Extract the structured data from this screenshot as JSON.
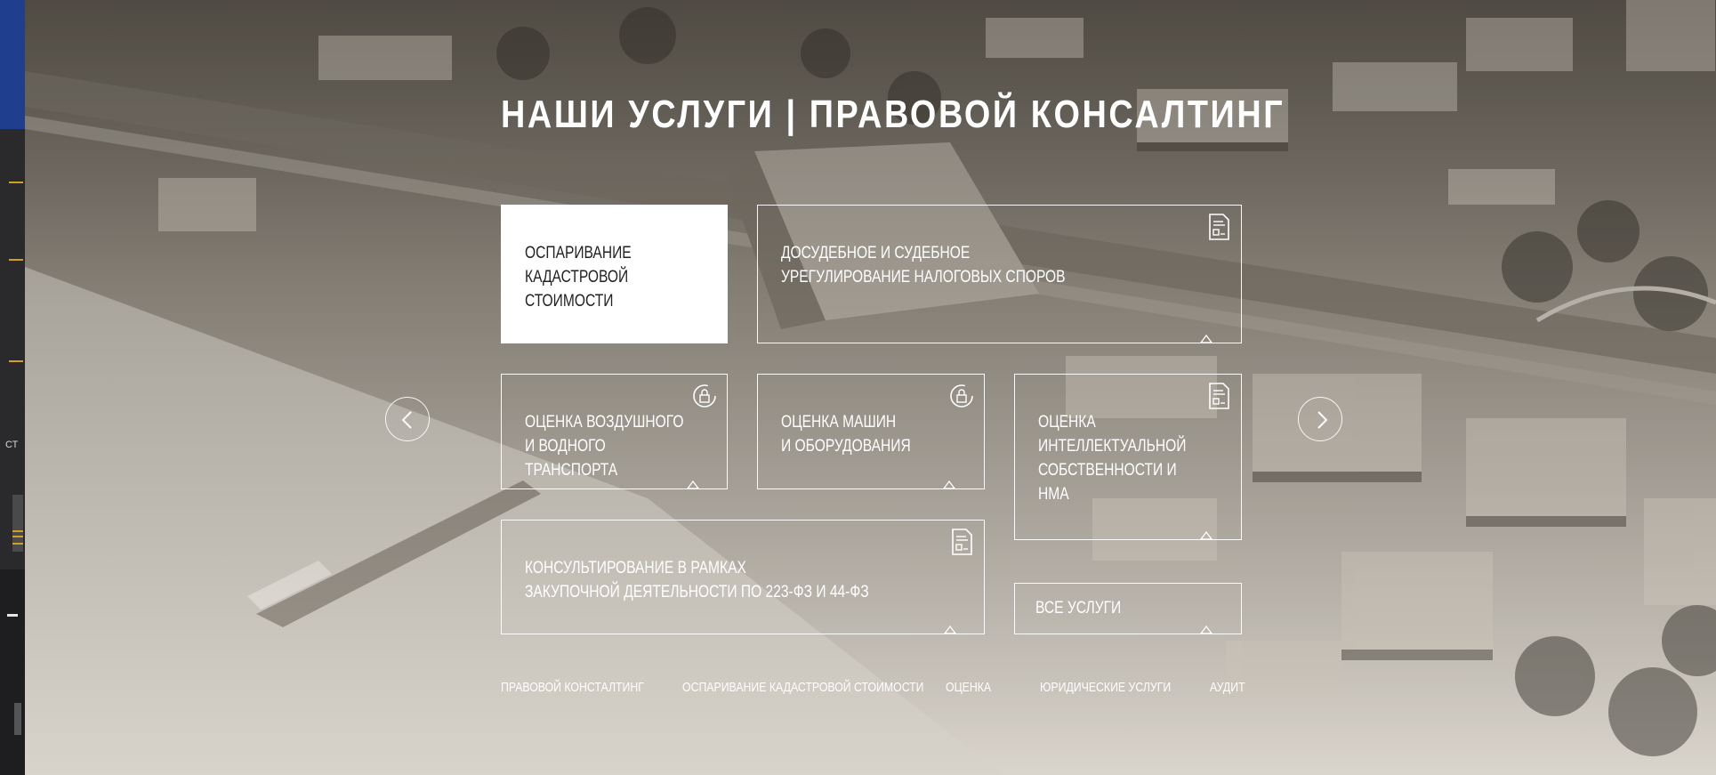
{
  "page": {
    "title": "НАШИ УСЛУГИ | ПРАВОВОЙ КОНСАЛТИНГ"
  },
  "sidebar": {
    "fragment_text": "СТ"
  },
  "cards": [
    {
      "label": "ОСПАРИВАНИЕ\nКАДАСТРОВОЙ\nСТОИМОСТИ",
      "icon": "none",
      "active": true
    },
    {
      "label": "ДОСУДЕБНОЕ И СУДЕБНОЕ\nУРЕГУЛИРОВАНИЕ НАЛОГОВЫХ СПОРОВ",
      "icon": "document-icon"
    },
    {
      "label": "ОЦЕНКА ВОЗДУШНОГО\nИ ВОДНОГО ТРАНСПОРТА",
      "icon": "refresh-lock-icon"
    },
    {
      "label": "ОЦЕНКА МАШИН\nИ ОБОРУДОВАНИЯ",
      "icon": "refresh-lock-icon"
    },
    {
      "label": "ОЦЕНКА\nИНТЕЛЛЕКТУАЛЬНОЙ\nСОБСТВЕННОСТИ И\nНМА",
      "icon": "document-icon"
    },
    {
      "label": "КОНСУЛЬТИРОВАНИЕ В РАМКАХ\nЗАКУПОЧНОЙ ДЕЯТЕЛЬНОСТИ ПО 223-ФЗ И 44-ФЗ",
      "icon": "document-icon"
    },
    {
      "label": "ВСЕ УСЛУГИ",
      "icon": "none"
    }
  ],
  "bottom_nav": [
    "ПРАВОВОЙ КОНСТАЛТИНГ",
    "ОСПАРИВАНИЕ КАДАСТРОВОЙ СТОИМОСТИ",
    "ОЦЕНКА",
    "ЮРИДИЧЕСКИЕ УСЛУГИ",
    "АУДИТ"
  ],
  "colors": {
    "rail": "#2a2a2c",
    "rail_accent": "#1f3f8e",
    "rail_ticks": "#d2a020",
    "card_border": "#ffffff",
    "active_card_bg": "#ffffff",
    "active_card_text": "#222222"
  }
}
